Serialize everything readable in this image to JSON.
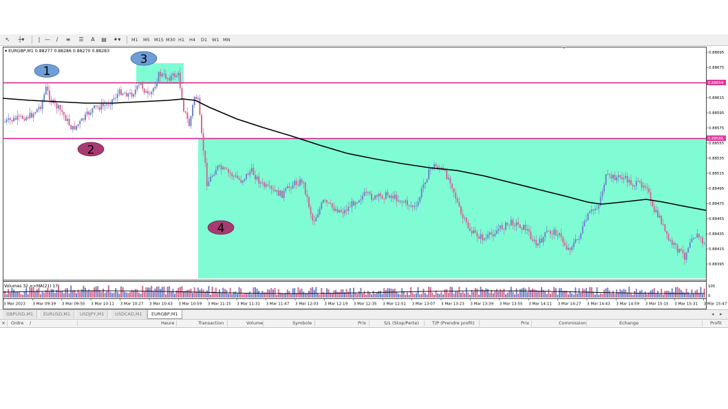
{
  "toolbar": {
    "timeframes": [
      "M1",
      "M5",
      "M15",
      "M30",
      "H1",
      "H4",
      "D1",
      "W1",
      "MN"
    ]
  },
  "chart": {
    "header": "▾ EURGBP,M1  0.88277 0.88286 0.88270 0.88283",
    "volume_label": "Volumes 32  =>MA(21) 17",
    "price_axis": [
      "0.88695",
      "0.88675",
      "0.88635",
      "0.88615",
      "0.88595",
      "0.88575",
      "0.88555",
      "0.88535",
      "0.88515",
      "0.88495",
      "0.88475",
      "0.88455",
      "0.88435",
      "0.88415",
      "0.88395"
    ],
    "badge_upper": "0.88654",
    "badge_lower": "0.88580",
    "volume_axis": [
      "105",
      "0"
    ],
    "time_axis": [
      "3 Mar 2023",
      "3 Mar 09:39",
      "3 Mar 09:55",
      "3 Mar 10:11",
      "3 Mar 10:27",
      "3 Mar 10:43",
      "3 Mar 10:59",
      "3 Mar 11:15",
      "3 Mar 11:31",
      "3 Mar 11:47",
      "3 Mar 12:03",
      "3 Mar 12:19",
      "3 Mar 12:35",
      "3 Mar 12:51",
      "3 Mar 13:07",
      "3 Mar 13:23",
      "3 Mar 13:39",
      "3 Mar 13:55",
      "3 Mar 14:11",
      "3 Mar 14:27",
      "3 Mar 14:43",
      "3 Mar 14:59",
      "3 Mar 15:15",
      "3 Mar 15:31",
      "3 Mar 15:47"
    ],
    "annotations": [
      "1",
      "2",
      "3",
      "4"
    ],
    "colors": {
      "bull": "#6f84c9",
      "bear": "#d06a94",
      "zone": "#7ffcd4",
      "level": "#d6198a",
      "ma": "#000000",
      "badge": "#e0389a",
      "ellipse_blue": "#6e9ed6",
      "ellipse_purple": "#a83a72"
    }
  },
  "tabs": [
    "GBPUSD,M1",
    "EURUSD,M1",
    "USDJPY,M1",
    "USDCAD,M1",
    "EURGBP,M1"
  ],
  "orders_columns": [
    "Ordre",
    "/",
    "Heure",
    "Transaction",
    "Volume",
    "Symbole",
    "Prix",
    "S/L (Stop/Perte)",
    "T/P (Prendre profit)",
    "Prix",
    "Commission",
    "Echange",
    "Profit"
  ],
  "close_glyph": "×",
  "tab_nav": [
    "◂",
    "▸"
  ]
}
